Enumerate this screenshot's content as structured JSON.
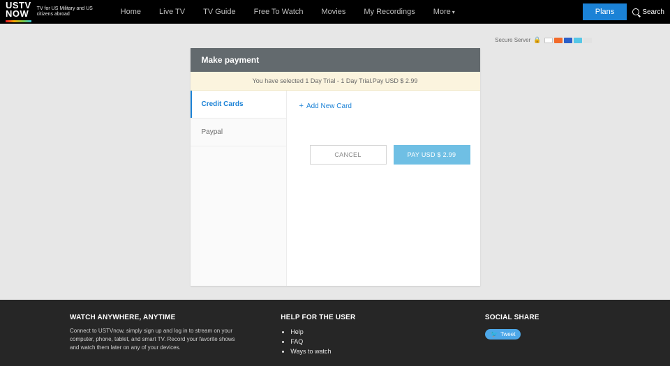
{
  "header": {
    "logo_top": "USTV",
    "logo_bot": "NOW",
    "tagline": "TV for US Military and US citizens abroad",
    "nav": [
      "Home",
      "Live TV",
      "TV Guide",
      "Free To Watch",
      "Movies",
      "My Recordings",
      "More"
    ],
    "plans": "Plans",
    "search": "Search"
  },
  "secure": {
    "label": "Secure Server"
  },
  "panel": {
    "title": "Make payment",
    "banner": "You have selected 1 Day Trial - 1 Day Trial.Pay USD $ 2.99",
    "side": {
      "credit": "Credit Cards",
      "paypal": "Paypal"
    },
    "add_new": "Add New Card",
    "cancel": "CANCEL",
    "pay": "PAY USD $ 2.99"
  },
  "footer": {
    "col1_title": "WATCH ANYWHERE, ANYTIME",
    "col1_body": "Connect to USTVnow, simply sign up and log in to stream on your computer, phone, tablet, and smart TV. Record your favorite shows and watch them later on any of your devices.",
    "col2_title": "HELP FOR THE USER",
    "col2_items": [
      "Help",
      "FAQ",
      "Ways to watch"
    ],
    "col3_title": "SOCIAL SHARE",
    "tweet": "Tweet"
  }
}
